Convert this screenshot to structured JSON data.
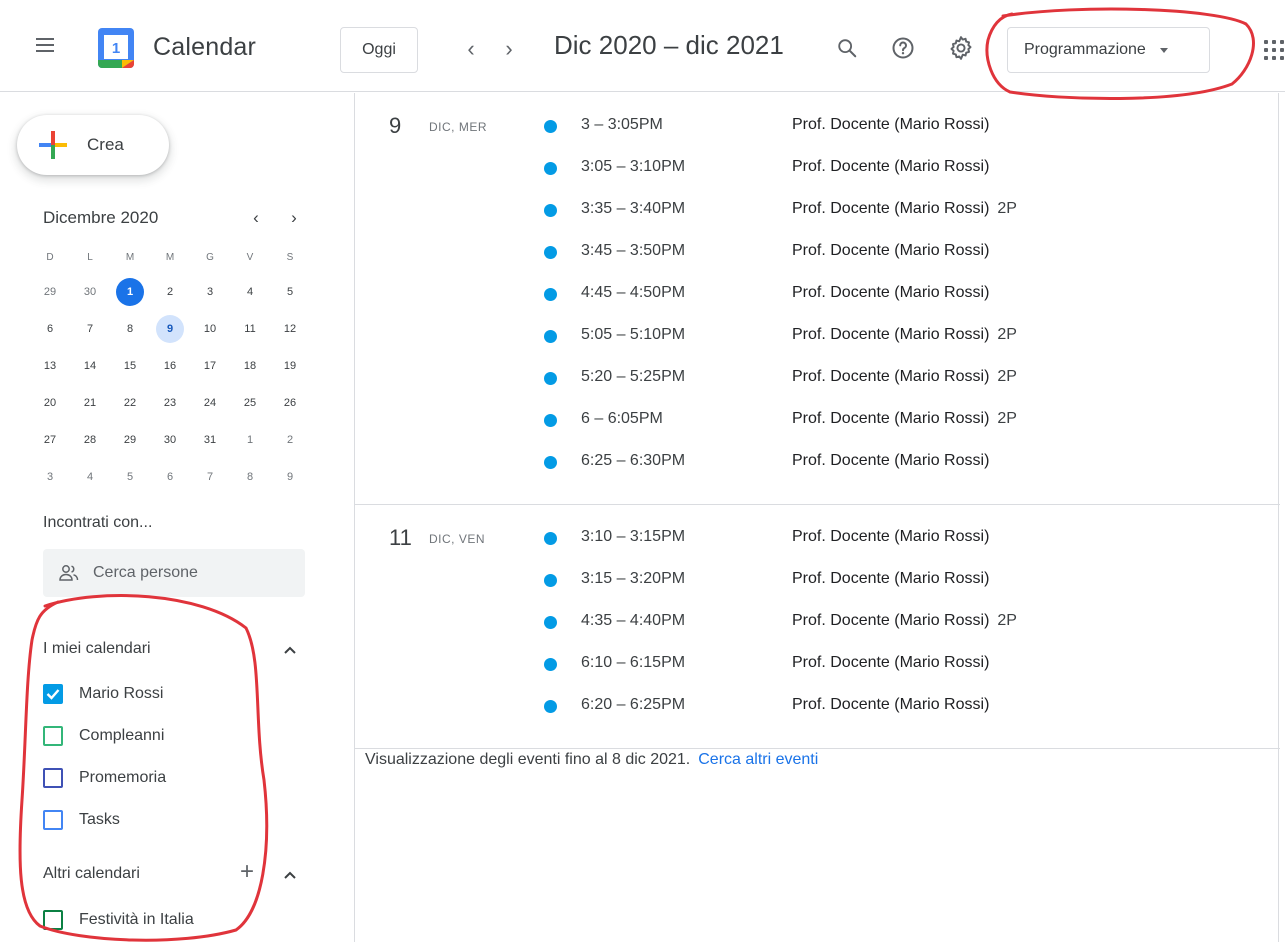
{
  "header": {
    "app_title": "Calendar",
    "today_label": "Oggi",
    "range_title": "Dic 2020 – dic 2021",
    "view_label": "Programmazione",
    "logo_day": "1"
  },
  "sidebar": {
    "create_label": "Crea",
    "mini_calendar": {
      "month_title": "Dicembre 2020",
      "weekdays": [
        "D",
        "L",
        "M",
        "M",
        "G",
        "V",
        "S"
      ],
      "weeks": [
        [
          "29",
          "30",
          "1",
          "2",
          "3",
          "4",
          "5"
        ],
        [
          "6",
          "7",
          "8",
          "9",
          "10",
          "11",
          "12"
        ],
        [
          "13",
          "14",
          "15",
          "16",
          "17",
          "18",
          "19"
        ],
        [
          "20",
          "21",
          "22",
          "23",
          "24",
          "25",
          "26"
        ],
        [
          "27",
          "28",
          "29",
          "30",
          "31",
          "1",
          "2"
        ],
        [
          "3",
          "4",
          "5",
          "6",
          "7",
          "8",
          "9"
        ]
      ]
    },
    "meet_title": "Incontrati con...",
    "search_people_placeholder": "Cerca persone",
    "my_calendars_title": "I miei calendari",
    "my_calendars": [
      {
        "label": "Mario Rossi",
        "color": "#039be5",
        "checked": true
      },
      {
        "label": "Compleanni",
        "color": "#33b679",
        "checked": false
      },
      {
        "label": "Promemoria",
        "color": "#3f51b5",
        "checked": false
      },
      {
        "label": "Tasks",
        "color": "#4285f4",
        "checked": false
      }
    ],
    "other_calendars_title": "Altri calendari",
    "other_calendars": [
      {
        "label": "Festività in Italia",
        "color": "#0b8043",
        "checked": false
      }
    ]
  },
  "schedule": {
    "days": [
      {
        "day_number": "9",
        "day_label": "DIC, MER",
        "events": [
          {
            "time": "3 – 3:05PM",
            "title": "Prof. Docente (Mario Rossi)",
            "tag": ""
          },
          {
            "time": "3:05 – 3:10PM",
            "title": "Prof. Docente (Mario Rossi)",
            "tag": ""
          },
          {
            "time": "3:35 – 3:40PM",
            "title": "Prof. Docente (Mario Rossi)",
            "tag": "2P"
          },
          {
            "time": "3:45 – 3:50PM",
            "title": "Prof. Docente (Mario Rossi)",
            "tag": ""
          },
          {
            "time": "4:45 – 4:50PM",
            "title": "Prof. Docente (Mario Rossi)",
            "tag": ""
          },
          {
            "time": "5:05 – 5:10PM",
            "title": "Prof. Docente (Mario Rossi)",
            "tag": "2P"
          },
          {
            "time": "5:20 – 5:25PM",
            "title": "Prof. Docente (Mario Rossi)",
            "tag": "2P"
          },
          {
            "time": "6 – 6:05PM",
            "title": "Prof. Docente (Mario Rossi)",
            "tag": "2P"
          },
          {
            "time": "6:25 – 6:30PM",
            "title": "Prof. Docente (Mario Rossi)",
            "tag": ""
          }
        ]
      },
      {
        "day_number": "11",
        "day_label": "DIC, VEN",
        "events": [
          {
            "time": "3:10 – 3:15PM",
            "title": "Prof. Docente (Mario Rossi)",
            "tag": ""
          },
          {
            "time": "3:15 – 3:20PM",
            "title": "Prof. Docente (Mario Rossi)",
            "tag": ""
          },
          {
            "time": "4:35 – 4:40PM",
            "title": "Prof. Docente (Mario Rossi)",
            "tag": "2P"
          },
          {
            "time": "6:10 – 6:15PM",
            "title": "Prof. Docente (Mario Rossi)",
            "tag": ""
          },
          {
            "time": "6:20 – 6:25PM",
            "title": "Prof. Docente (Mario Rossi)",
            "tag": ""
          }
        ]
      }
    ],
    "footer_note": "Visualizzazione degli eventi fino al 8 dic 2021.",
    "footer_link": "Cerca altri eventi"
  },
  "icons": {
    "menu": "hamburger-menu-icon",
    "search": "search-icon",
    "help": "help-icon",
    "settings": "gear-icon",
    "apps": "apps-grid-icon"
  },
  "colors": {
    "accent": "#1a73e8",
    "event_dot": "#039be5",
    "annotation": "#e0343b"
  }
}
